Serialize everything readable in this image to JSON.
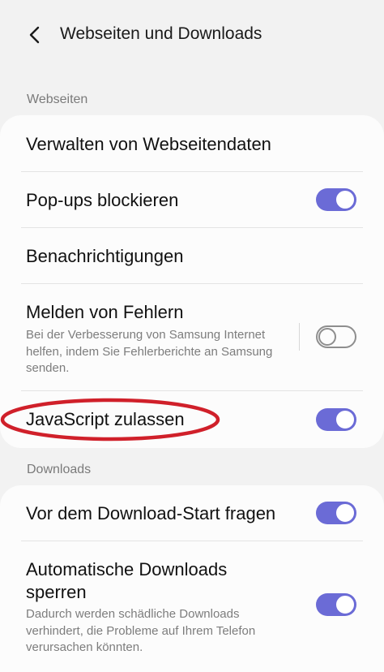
{
  "header": {
    "title": "Webseiten und Downloads",
    "back_icon": "chevron-left-icon"
  },
  "sections": {
    "webpages": {
      "label": "Webseiten",
      "items": {
        "manage_data": {
          "title": "Verwalten von Webseitendaten"
        },
        "block_popups": {
          "title": "Pop-ups blockieren",
          "enabled": true
        },
        "notifications": {
          "title": "Benachrichtigungen"
        },
        "report_errors": {
          "title": "Melden von Fehlern",
          "subtitle": "Bei der Verbesserung von Samsung Internet helfen, indem Sie Fehlerberichte an Samsung senden.",
          "enabled": false
        },
        "allow_js": {
          "title": "JavaScript zulassen",
          "enabled": true
        }
      }
    },
    "downloads": {
      "label": "Downloads",
      "items": {
        "ask_before": {
          "title": "Vor dem Download-Start fragen",
          "enabled": true
        },
        "block_auto": {
          "title": "Automatische Downloads sperren",
          "subtitle": "Dadurch werden schädliche Downloads verhindert, die Probleme auf Ihrem Telefon verursachen könnten.",
          "enabled": true
        }
      }
    }
  },
  "colors": {
    "accent": "#6b6bd6",
    "annotation": "#d0202a",
    "background": "#f2f2f2",
    "card": "#fcfcfc"
  }
}
